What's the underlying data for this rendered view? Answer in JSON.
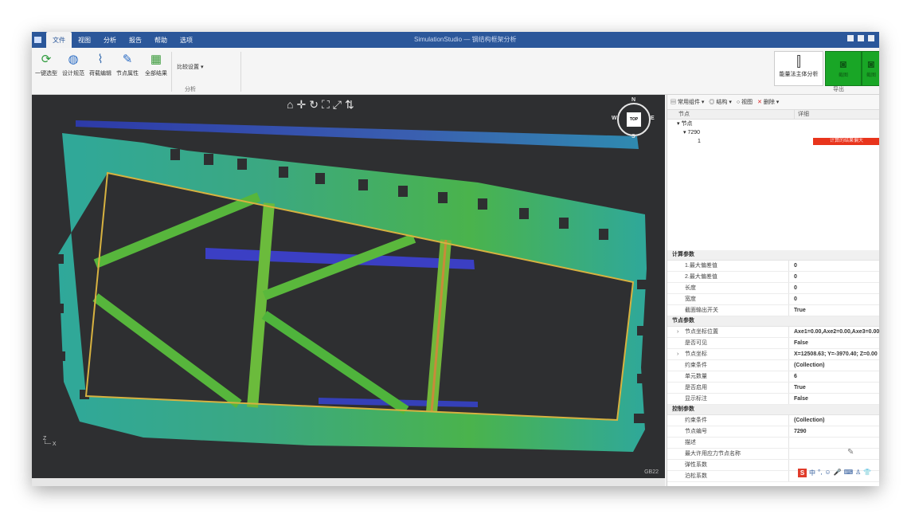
{
  "menu": {
    "items": [
      "文件",
      "视图",
      "分析",
      "报告",
      "帮助",
      "选项"
    ],
    "active_index": 1
  },
  "window_title": "SimulationStudio — 钢结构框架分析",
  "ribbon": {
    "buttons": [
      {
        "label": "一键选型",
        "icon": "refresh-icon"
      },
      {
        "label": "设计规范",
        "icon": "globe-icon"
      },
      {
        "label": "荷载编辑",
        "icon": "chart-icon"
      },
      {
        "label": "节点属性",
        "icon": "pin-icon"
      },
      {
        "label": "全部结果",
        "icon": "image-icon"
      }
    ],
    "dropdown_label": "比较设置",
    "group_label": "分析",
    "right_button_label": "能量法主体分析",
    "green_button_1_label": "截图",
    "green_button_2_label": "截图",
    "right_group_label": "导出"
  },
  "viewport": {
    "toolbar_icons": [
      "home-icon",
      "pan-icon",
      "rotate-icon",
      "fit-icon",
      "zoom-icon",
      "axis-icon"
    ],
    "toolbar_glyphs": [
      "⌂",
      "✛",
      "↻",
      "⛶",
      "⤢",
      "⇅"
    ],
    "compass": {
      "cube": "TOP",
      "n": "N",
      "s": "S",
      "e": "E",
      "w": "W"
    },
    "corner_text": "GB22"
  },
  "tree": {
    "toolbar": {
      "a": "常用组件",
      "b": "结构",
      "c": "视图",
      "d": "删除"
    },
    "columns": [
      "节点",
      "详细"
    ],
    "rows": [
      {
        "label": "节点",
        "indent": 1
      },
      {
        "label": "7290",
        "indent": 2
      },
      {
        "label": "1",
        "indent": 3
      }
    ],
    "red_value": "计算的结果偏大"
  },
  "properties": {
    "categories": [
      {
        "name": "计算参数",
        "rows": [
          {
            "key": "1.最大偏差值",
            "value": "0",
            "expand": false
          },
          {
            "key": "2.最大偏差值",
            "value": "0",
            "expand": false
          },
          {
            "key": "长度",
            "value": "0",
            "expand": false
          },
          {
            "key": "宽度",
            "value": "0",
            "expand": false
          },
          {
            "key": "截面输出开关",
            "value": "True",
            "expand": false
          }
        ]
      },
      {
        "name": "节点参数",
        "rows": [
          {
            "key": "节点坐标位置",
            "value": "Axe1=0.00,Axe2=0.00,Axe3=0.00",
            "expand": true
          },
          {
            "key": "是否可见",
            "value": "False",
            "expand": false
          },
          {
            "key": "节点坐标",
            "value": "X=12508.63; Y=-3970.40; Z=0.00",
            "expand": true
          },
          {
            "key": "约束条件",
            "value": "(Collection)",
            "expand": false
          },
          {
            "key": "单元数量",
            "value": "6",
            "expand": false
          },
          {
            "key": "是否启用",
            "value": "True",
            "expand": false
          },
          {
            "key": "显示标注",
            "value": "False",
            "expand": false
          }
        ]
      },
      {
        "name": "控制参数",
        "rows": [
          {
            "key": "约束条件",
            "value": "(Collection)",
            "expand": false
          },
          {
            "key": "节点编号",
            "value": "7290",
            "expand": false
          },
          {
            "key": "描述",
            "value": "",
            "expand": false
          },
          {
            "key": "最大许用应力节点名称",
            "value": "",
            "expand": false
          },
          {
            "key": "弹性系数",
            "value": "",
            "expand": false
          },
          {
            "key": "泊松系数",
            "value": "",
            "expand": false
          }
        ]
      }
    ]
  },
  "ime": {
    "badge": "S",
    "glyphs": [
      "中",
      "°,",
      "☺",
      "🎤",
      "⌨",
      "♙",
      "👕"
    ]
  },
  "colors": {
    "title_bar": "#2b579a",
    "viewport_bg": "#2e2f31",
    "frame_green": "#4ab34c",
    "frame_teal": "#2fa89a",
    "highlight_red": "#e8341c",
    "green_button": "#19a626"
  }
}
